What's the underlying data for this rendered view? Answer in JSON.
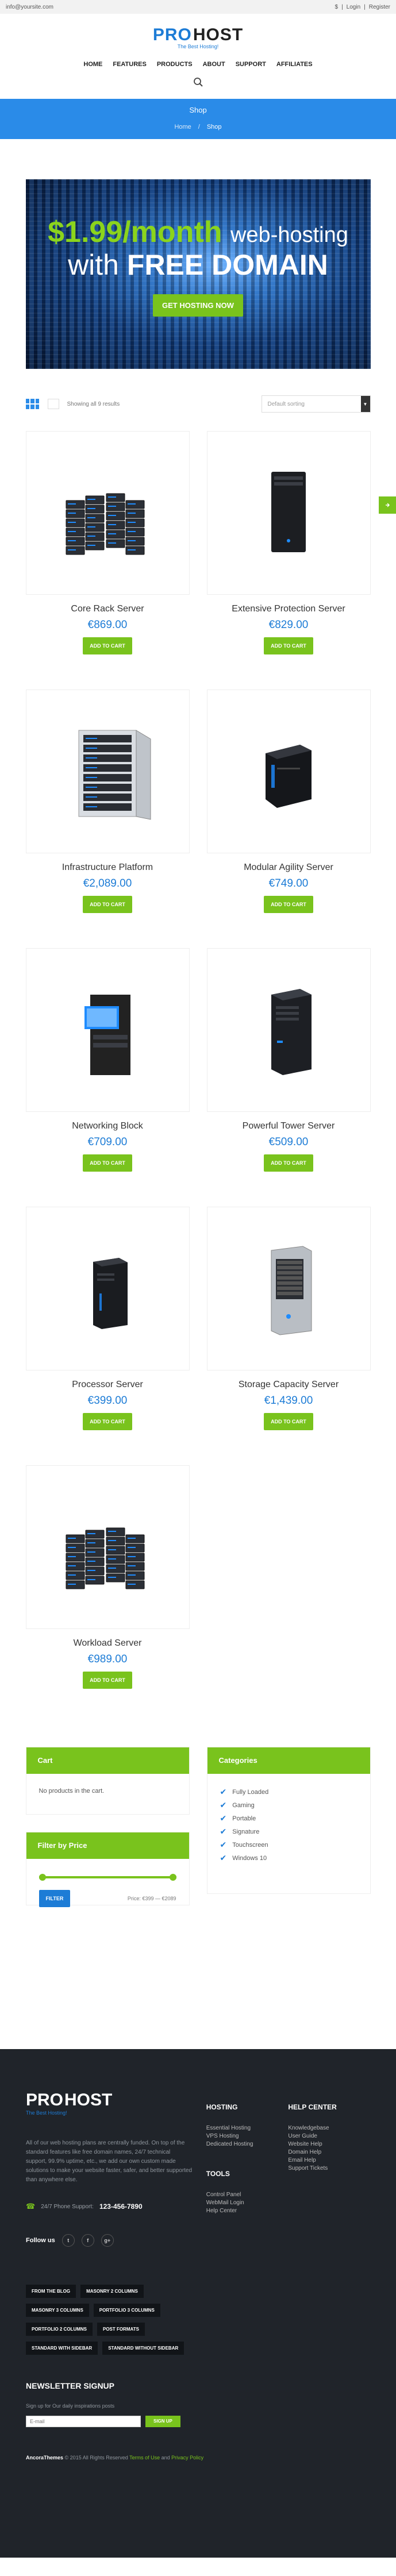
{
  "topbar": {
    "email": "info@yoursite.com",
    "currency": "$",
    "login": "Login",
    "register": "Register",
    "sep": "|"
  },
  "logo": {
    "pro": "PRO",
    "host": "HOST",
    "tagline": "The Best Hosting!"
  },
  "nav": [
    "HOME",
    "FEATURES",
    "PRODUCTS",
    "ABOUT",
    "SUPPORT",
    "AFFILIATES"
  ],
  "banner": {
    "title": "Shop",
    "breadcrumb_home": "Home",
    "breadcrumb_sep": "/",
    "breadcrumb_current": "Shop"
  },
  "hero": {
    "price": "$1.99/month",
    "price_suffix": "web-hosting",
    "with": "with",
    "free_domain": "FREE DOMAIN",
    "cta": "GET HOSTING NOW"
  },
  "toolbar": {
    "results": "Showing all 9 results",
    "sort_placeholder": "Default sorting"
  },
  "products": [
    {
      "name": "Core Rack Server",
      "price": "€869.00",
      "cta": "ADD TO CART",
      "icon": "rack-server-cluster"
    },
    {
      "name": "Extensive Protection Server",
      "price": "€829.00",
      "cta": "ADD TO CART",
      "icon": "tower-server-black"
    },
    {
      "name": "Infrastructure Platform",
      "price": "€2,089.00",
      "cta": "ADD TO CART",
      "icon": "server-cabinet-open"
    },
    {
      "name": "Modular Agility Server",
      "price": "€749.00",
      "cta": "ADD TO CART",
      "icon": "cube-server"
    },
    {
      "name": "Networking Block",
      "price": "€709.00",
      "cta": "ADD TO CART",
      "icon": "server-with-monitor"
    },
    {
      "name": "Powerful Tower Server",
      "price": "€509.00",
      "cta": "ADD TO CART",
      "icon": "tower-server-blue"
    },
    {
      "name": "Processor Server",
      "price": "€399.00",
      "cta": "ADD TO CART",
      "icon": "mini-tower-server"
    },
    {
      "name": "Storage Capacity Server",
      "price": "€1,439.00",
      "cta": "ADD TO CART",
      "icon": "storage-tower-silver"
    },
    {
      "name": "Workload Server",
      "price": "€989.00",
      "cta": "ADD TO CART",
      "icon": "rack-server-cluster"
    }
  ],
  "cart_widget": {
    "title": "Cart",
    "empty": "No products in the cart."
  },
  "categories_widget": {
    "title": "Categories",
    "items": [
      "Fully Loaded",
      "Gaming",
      "Portable",
      "Signature",
      "Touchscreen",
      "Windows 10"
    ]
  },
  "filter_widget": {
    "title": "Filter by Price",
    "button": "FILTER",
    "price_label": "Price:",
    "price_range": "€399 — €2089"
  },
  "footer": {
    "about": "All of our web hosting plans are centrally funded. On top of the standard features like free domain names, 24/7 technical support, 99.9% uptime, etc., we add our own custom made solutions to make your website faster, safer, and better supported than anywhere else.",
    "phone_label": "24/7 Phone Support:",
    "phone": "123-456-7890",
    "follow_label": "Follow us",
    "socials": [
      "t",
      "f",
      "g+"
    ],
    "hosting_title": "HOSTING",
    "hosting_links": [
      "Essential Hosting",
      "VPS Hosting",
      "Dedicated Hosting"
    ],
    "tools_title": "TOOLS",
    "tools_links": [
      "Control Panel",
      "WebMail Login",
      "Help Center"
    ],
    "help_title": "HELP CENTER",
    "help_links": [
      "Knowledgebase",
      "User Guide",
      "Website Help",
      "Domain Help",
      "Email Help",
      "Support Tickets"
    ],
    "tags": [
      "FROM THE BLOG",
      "MASONRY 2 COLUMNS",
      "MASONRY 3 COLUMNS",
      "PORTFOLIO 3 COLUMNS",
      "PORTFOLIO 2 COLUMNS",
      "POST FORMATS",
      "STANDARD WITH SIDEBAR",
      "STANDARD WITHOUT SIDEBAR"
    ],
    "newsletter_title": "NEWSLETTER SIGNUP",
    "newsletter_text": "Sign up for Our daily inspirations posts",
    "newsletter_placeholder": "E-mail",
    "newsletter_button": "SIGN UP",
    "copy_brand": "AncoraThemes",
    "copy_text": "© 2015 All Rights Reserved",
    "copy_terms": "Terms of Use",
    "copy_and": "and",
    "copy_privacy": "Privacy Policy"
  },
  "colors": {
    "primary": "#1d7cd6",
    "accent": "#79c31d",
    "banner": "#2a8be8",
    "footer": "#20242a"
  }
}
